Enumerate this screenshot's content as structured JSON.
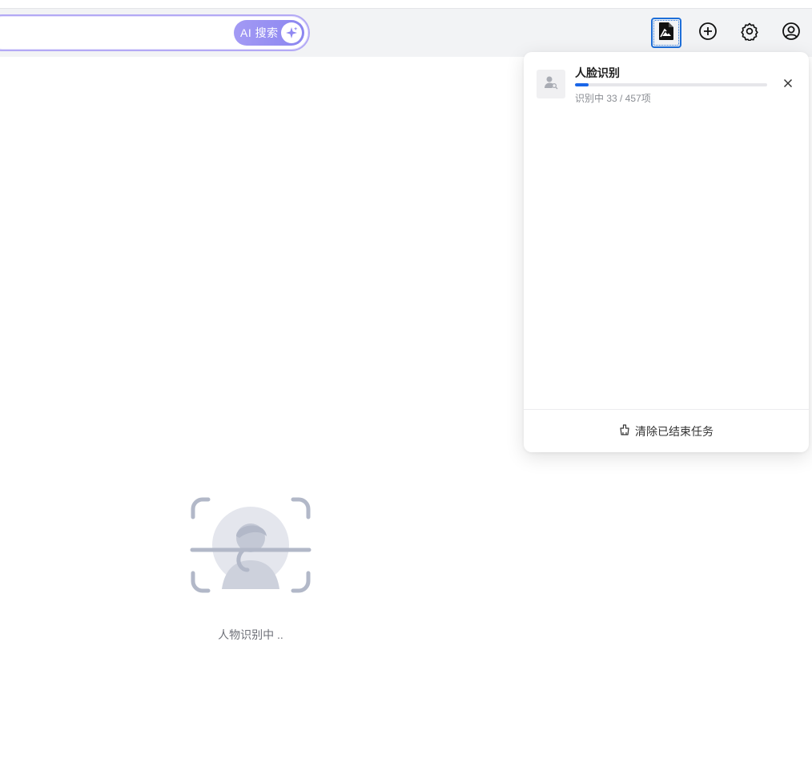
{
  "colors": {
    "accent": "#1a66e8",
    "ai_gradient_start": "#a39af4",
    "ai_gradient_end": "#8b86f0",
    "illustration": "#b2b8c8"
  },
  "toolbar": {
    "ai_search_label": "AI 搜索",
    "icons": [
      "ai-sparkle-icon",
      "tasks-icon",
      "add-circle-icon",
      "gear-icon",
      "account-icon"
    ]
  },
  "task_panel": {
    "task": {
      "title": "人脸识别",
      "status": "识别中 33 / 457项",
      "progress": 0.072,
      "thumb_icon": "face-search-icon"
    },
    "clear_label": "清除已结束任务"
  },
  "empty_state": {
    "text": "人物识别中 .."
  }
}
